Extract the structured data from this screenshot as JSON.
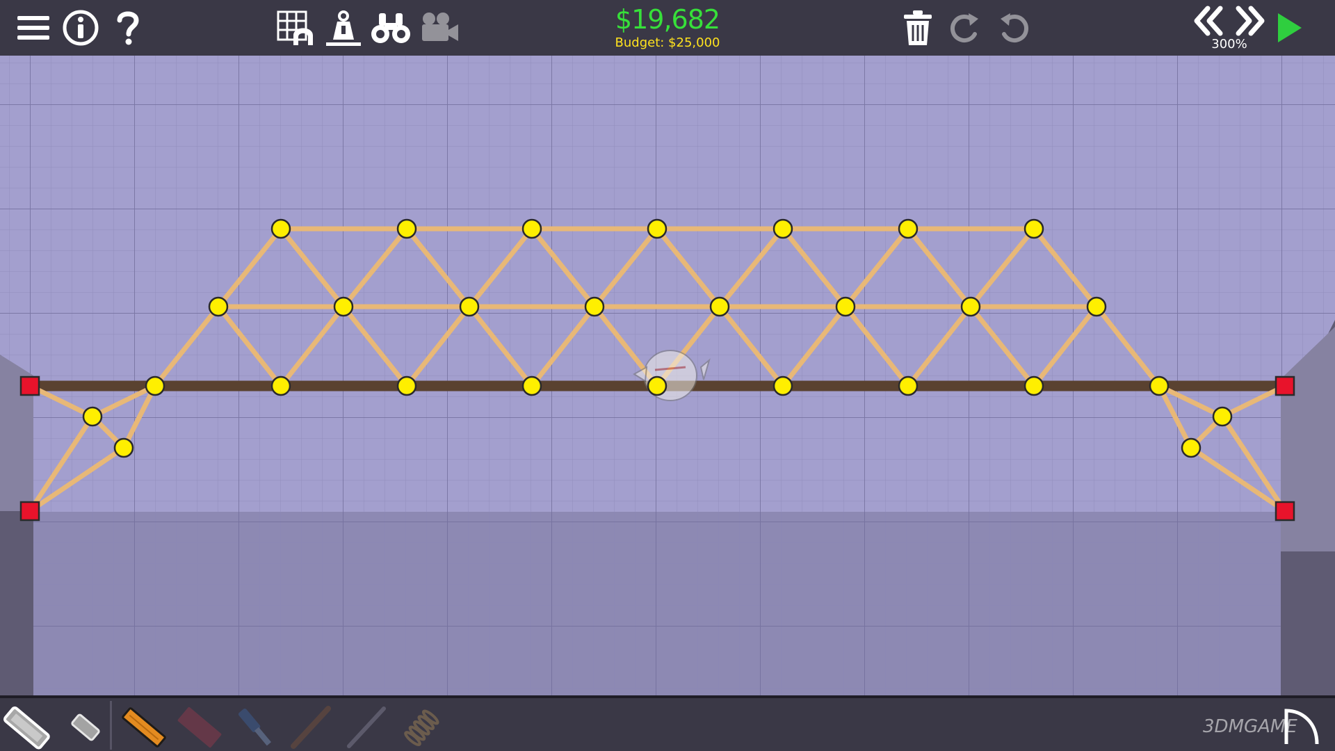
{
  "toolbar": {
    "cost": "$19,682",
    "budget_line": "Budget: $25,000",
    "zoom": "300%"
  },
  "icons": {
    "menu": "hamburger-menu-icon",
    "info": "info-circle-icon",
    "help": "question-mark-icon",
    "grid": "grid-arch-icon",
    "weight": "weight-icon",
    "binoculars": "binoculars-icon",
    "camera": "video-camera-icon",
    "trash": "trash-can-icon",
    "redo": "redo-arrow-icon",
    "undo": "undo-arrow-icon",
    "rewind": "double-chevron-left-icon",
    "fast_forward": "double-chevron-right-icon",
    "play": "play-triangle-icon",
    "exit": "exit-arc-icon"
  },
  "materials": [
    "road",
    "reinforced-road",
    "wood",
    "steel",
    "hydraulic",
    "rope",
    "cable",
    "spring"
  ],
  "colors": {
    "cost_green": "#37e03a",
    "budget_yellow": "#ffe21e",
    "play_green": "#2fce3f",
    "joint_yellow": "#ffef00",
    "anchor_red": "#e8132b",
    "wood_beam": "#e8b877",
    "road_deck": "#5a4230",
    "sky_purple": "#a39fce",
    "water_purple": "#8d89b3"
  },
  "watermark": "3DMGAME"
}
